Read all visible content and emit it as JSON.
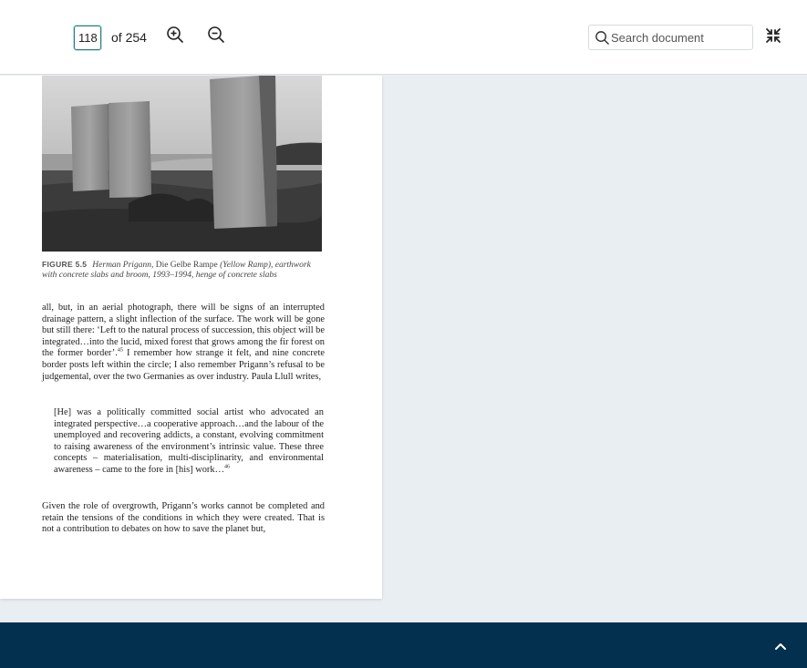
{
  "toolbar": {
    "current_page": "118",
    "of_label": "of 254",
    "search_placeholder": "Search document"
  },
  "page": {
    "figure_label": "FIGURE 5.5",
    "figure_caption_italic_1": "Herman Prigann, ",
    "figure_caption_roman": "Die Gelbe Rampe",
    "figure_caption_italic_2": " (Yellow Ramp), earthwork with concrete slabs and broom, 1993–1994, henge of concrete slabs",
    "para1_a": "all, but, in an aerial photograph, there will be signs of an interrupted drainage pattern, a slight inflection of the surface. The work will be gone but still there: ‘Left to the natural process of succession, this object will be integrated…into the lucid, mixed forest that grows among the fir forest on the former border’.",
    "para1_note": "45",
    "para1_b": " I remember how strange it felt, and nine concrete border posts left within the circle; I also remember Prigann’s refusal to be judgemental, over the two Germanies as over industry. Paula Llull writes,",
    "quote_a": "[He] was a politically committed social artist who advocated an integrated perspective…a cooperative approach…and the labour of the unemployed and recovering addicts, a constant, evolving commitment to raising awareness of the environment’s intrinsic value. These three concepts – materialisation, multi-disciplinarity, and environmental awareness – came to the fore in [his] work…",
    "quote_note": "46",
    "para2": "Given the role of overgrowth, Prigann’s works cannot be completed and retain the tensions of the conditions in which they were created. That is not a contribution to debates on how to save the planet but,"
  },
  "colors": {
    "footer_bg": "#04304f",
    "viewer_bg": "#e9eef3",
    "accent": "#2b7a78"
  },
  "icons": [
    "zoom-in-icon",
    "zoom-out-icon",
    "search-icon",
    "collapse-icon",
    "chevron-up-icon"
  ]
}
